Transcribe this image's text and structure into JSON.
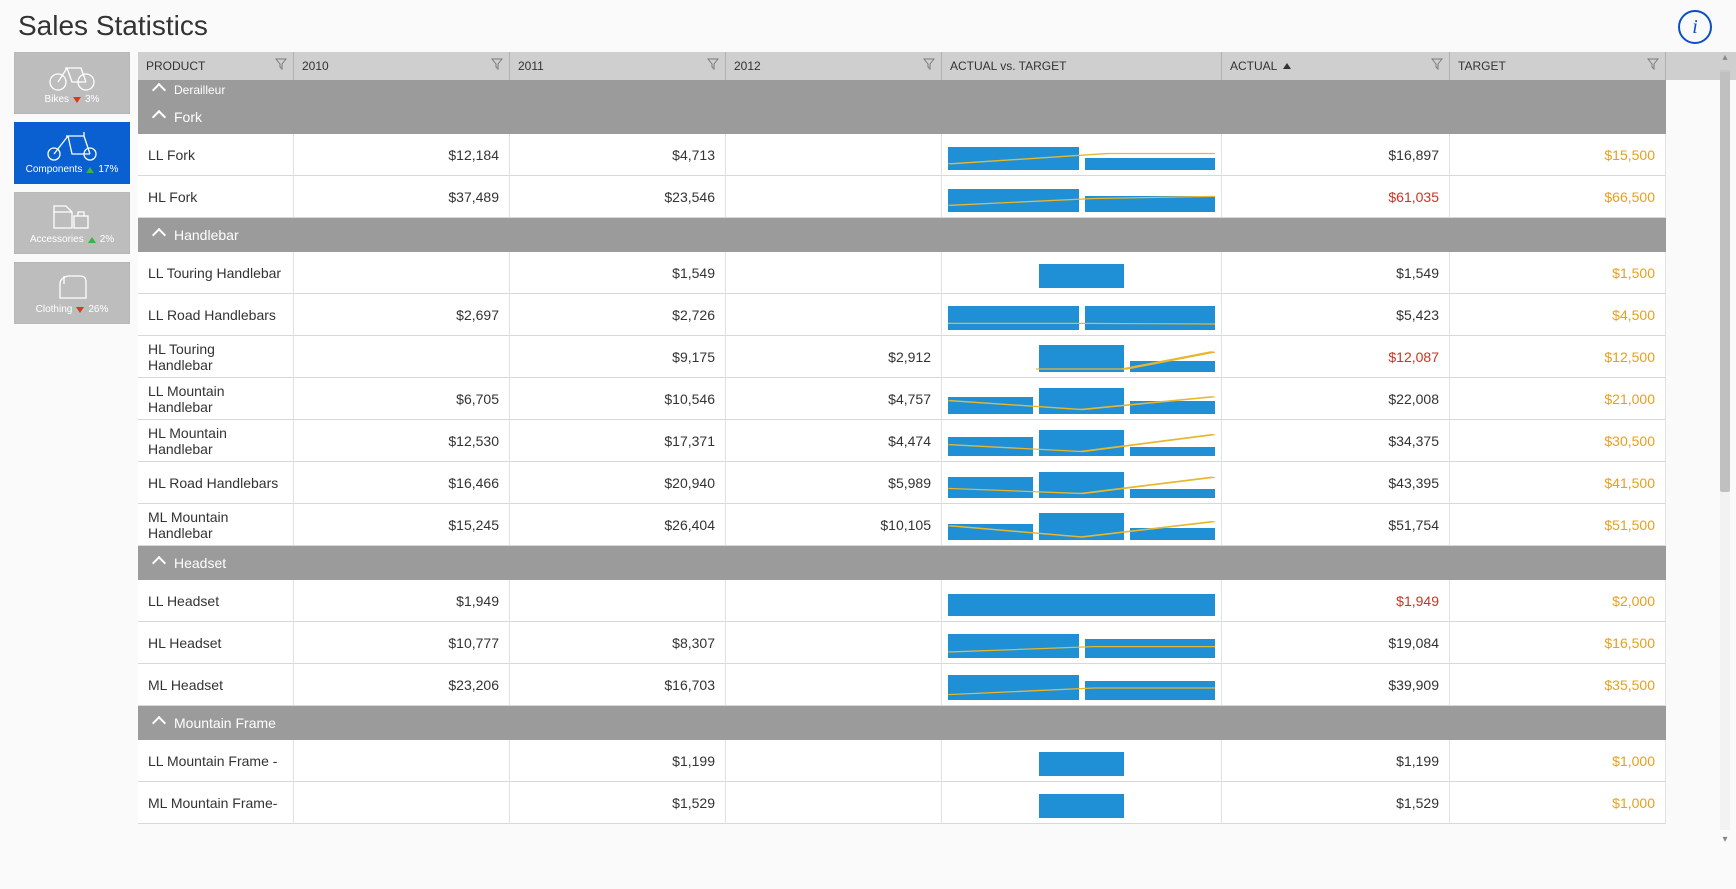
{
  "title": "Sales Statistics",
  "info_label": "i",
  "categories": [
    {
      "key": "bikes",
      "label": "Bikes",
      "change": "3%",
      "dir": "down",
      "active": false
    },
    {
      "key": "components",
      "label": "Components",
      "change": "17%",
      "dir": "up",
      "active": true
    },
    {
      "key": "accessories",
      "label": "Accessories",
      "change": "2%",
      "dir": "up",
      "active": false
    },
    {
      "key": "clothing",
      "label": "Clothing",
      "change": "26%",
      "dir": "down",
      "active": false
    }
  ],
  "columns": [
    {
      "key": "product",
      "label": "PRODUCT",
      "filter": true
    },
    {
      "key": "y2010",
      "label": "2010",
      "filter": true
    },
    {
      "key": "y2011",
      "label": "2011",
      "filter": true
    },
    {
      "key": "y2012",
      "label": "2012",
      "filter": true
    },
    {
      "key": "avt",
      "label": "ACTUAL vs. TARGET",
      "filter": false
    },
    {
      "key": "actual",
      "label": "ACTUAL",
      "filter": true,
      "sort": "asc"
    },
    {
      "key": "target",
      "label": "TARGET",
      "filter": true
    }
  ],
  "groups": [
    {
      "name": "Derailleur",
      "collapsed": true,
      "rows": []
    },
    {
      "name": "Fork",
      "collapsed": false,
      "rows": [
        {
          "product": "LL Fork",
          "y2010": "$12,184",
          "y2011": "$4,713",
          "y2012": "",
          "actual": "$16,897",
          "neg": false,
          "target": "$15,500",
          "bars": [
            75,
            40
          ],
          "line": [
            [
              0,
              20
            ],
            [
              60,
              55
            ],
            [
              100,
              55
            ]
          ]
        },
        {
          "product": "HL Fork",
          "y2010": "$37,489",
          "y2011": "$23,546",
          "y2012": "",
          "actual": "$61,035",
          "neg": true,
          "target": "$66,500",
          "bars": [
            75,
            52
          ],
          "line": [
            [
              0,
              22
            ],
            [
              55,
              45
            ],
            [
              100,
              52
            ]
          ]
        }
      ]
    },
    {
      "name": "Handlebar",
      "collapsed": false,
      "rows": [
        {
          "product": "LL Touring Handlebar",
          "y2010": "",
          "y2011": "$1,549",
          "y2012": "",
          "actual": "$1,549",
          "neg": false,
          "target": "$1,500",
          "bars": [
            0,
            80,
            0
          ],
          "line": null
        },
        {
          "product": "LL Road Handlebars",
          "y2010": "$2,697",
          "y2011": "$2,726",
          "y2012": "",
          "actual": "$5,423",
          "neg": false,
          "target": "$4,500",
          "bars": [
            78,
            80
          ],
          "line": [
            [
              0,
              22
            ],
            [
              50,
              22
            ],
            [
              100,
              20
            ]
          ]
        },
        {
          "product": "HL Touring Handlebar",
          "y2010": "",
          "y2011": "$9,175",
          "y2012": "$2,912",
          "actual": "$12,087",
          "neg": true,
          "target": "$12,500",
          "bars": [
            0,
            90,
            35
          ],
          "line": [
            [
              33,
              10
            ],
            [
              66,
              10
            ],
            [
              100,
              68
            ]
          ]
        },
        {
          "product": "LL Mountain Handlebar",
          "y2010": "$6,705",
          "y2011": "$10,546",
          "y2012": "$4,757",
          "actual": "$22,008",
          "neg": false,
          "target": "$21,000",
          "bars": [
            55,
            85,
            42
          ],
          "line": [
            [
              0,
              45
            ],
            [
              50,
              15
            ],
            [
              100,
              58
            ]
          ]
        },
        {
          "product": "HL Mountain Handlebar",
          "y2010": "$12,530",
          "y2011": "$17,371",
          "y2012": "$4,474",
          "actual": "$34,375",
          "neg": false,
          "target": "$30,500",
          "bars": [
            62,
            85,
            28
          ],
          "line": [
            [
              0,
              38
            ],
            [
              50,
              15
            ],
            [
              100,
              72
            ]
          ]
        },
        {
          "product": "HL Road Handlebars",
          "y2010": "$16,466",
          "y2011": "$20,940",
          "y2012": "$5,989",
          "actual": "$43,395",
          "neg": false,
          "target": "$41,500",
          "bars": [
            68,
            85,
            30
          ],
          "line": [
            [
              0,
              32
            ],
            [
              50,
              15
            ],
            [
              100,
              70
            ]
          ]
        },
        {
          "product": "ML Mountain Handlebar",
          "y2010": "$15,245",
          "y2011": "$26,404",
          "y2012": "$10,105",
          "actual": "$51,754",
          "neg": false,
          "target": "$51,500",
          "bars": [
            52,
            90,
            40
          ],
          "line": [
            [
              0,
              48
            ],
            [
              50,
              10
            ],
            [
              100,
              62
            ]
          ]
        }
      ]
    },
    {
      "name": "Headset",
      "collapsed": false,
      "rows": [
        {
          "product": "LL Headset",
          "y2010": "$1,949",
          "y2011": "",
          "y2012": "",
          "actual": "$1,949",
          "neg": true,
          "target": "$2,000",
          "bars": [
            72
          ],
          "line": null
        },
        {
          "product": "HL Headset",
          "y2010": "$10,777",
          "y2011": "$8,307",
          "y2012": "",
          "actual": "$19,084",
          "neg": false,
          "target": "$16,500",
          "bars": [
            80,
            62
          ],
          "line": [
            [
              0,
              20
            ],
            [
              55,
              38
            ],
            [
              100,
              38
            ]
          ]
        },
        {
          "product": "ML Headset",
          "y2010": "$23,206",
          "y2011": "$16,703",
          "y2012": "",
          "actual": "$39,909",
          "neg": false,
          "target": "$35,500",
          "bars": [
            82,
            62
          ],
          "line": [
            [
              0,
              18
            ],
            [
              55,
              40
            ],
            [
              100,
              40
            ]
          ]
        }
      ]
    },
    {
      "name": "Mountain Frame",
      "collapsed": false,
      "rows": [
        {
          "product": "LL Mountain Frame -",
          "y2010": "",
          "y2011": "$1,199",
          "y2012": "",
          "actual": "$1,199",
          "neg": false,
          "target": "$1,000",
          "bars": [
            0,
            80,
            0
          ],
          "line": null
        },
        {
          "product": "ML Mountain Frame-",
          "y2010": "",
          "y2011": "$1,529",
          "y2012": "",
          "actual": "$1,529",
          "neg": false,
          "target": "$1,000",
          "bars": [
            0,
            80,
            0
          ],
          "line": null
        }
      ]
    }
  ],
  "chart_data": {
    "type": "table",
    "title": "Sales Statistics",
    "columns": [
      "Product",
      "2010",
      "2011",
      "2012",
      "Actual",
      "Target"
    ],
    "groups": [
      {
        "name": "Fork",
        "rows": [
          [
            "LL Fork",
            12184,
            4713,
            null,
            16897,
            15500
          ],
          [
            "HL Fork",
            37489,
            23546,
            null,
            61035,
            66500
          ]
        ]
      },
      {
        "name": "Handlebar",
        "rows": [
          [
            "LL Touring Handlebar",
            null,
            1549,
            null,
            1549,
            1500
          ],
          [
            "LL Road Handlebars",
            2697,
            2726,
            null,
            5423,
            4500
          ],
          [
            "HL Touring Handlebar",
            null,
            9175,
            2912,
            12087,
            12500
          ],
          [
            "LL Mountain Handlebar",
            6705,
            10546,
            4757,
            22008,
            21000
          ],
          [
            "HL Mountain Handlebar",
            12530,
            17371,
            4474,
            34375,
            30500
          ],
          [
            "HL Road Handlebars",
            16466,
            20940,
            5989,
            43395,
            41500
          ],
          [
            "ML Mountain Handlebar",
            15245,
            26404,
            10105,
            51754,
            51500
          ]
        ]
      },
      {
        "name": "Headset",
        "rows": [
          [
            "LL Headset",
            1949,
            null,
            null,
            1949,
            2000
          ],
          [
            "HL Headset",
            10777,
            8307,
            null,
            19084,
            16500
          ],
          [
            "ML Headset",
            23206,
            16703,
            null,
            39909,
            35500
          ]
        ]
      },
      {
        "name": "Mountain Frame",
        "rows": [
          [
            "LL Mountain Frame -",
            null,
            1199,
            null,
            1199,
            1000
          ],
          [
            "ML Mountain Frame-",
            null,
            1529,
            null,
            1529,
            1000
          ]
        ]
      }
    ]
  }
}
